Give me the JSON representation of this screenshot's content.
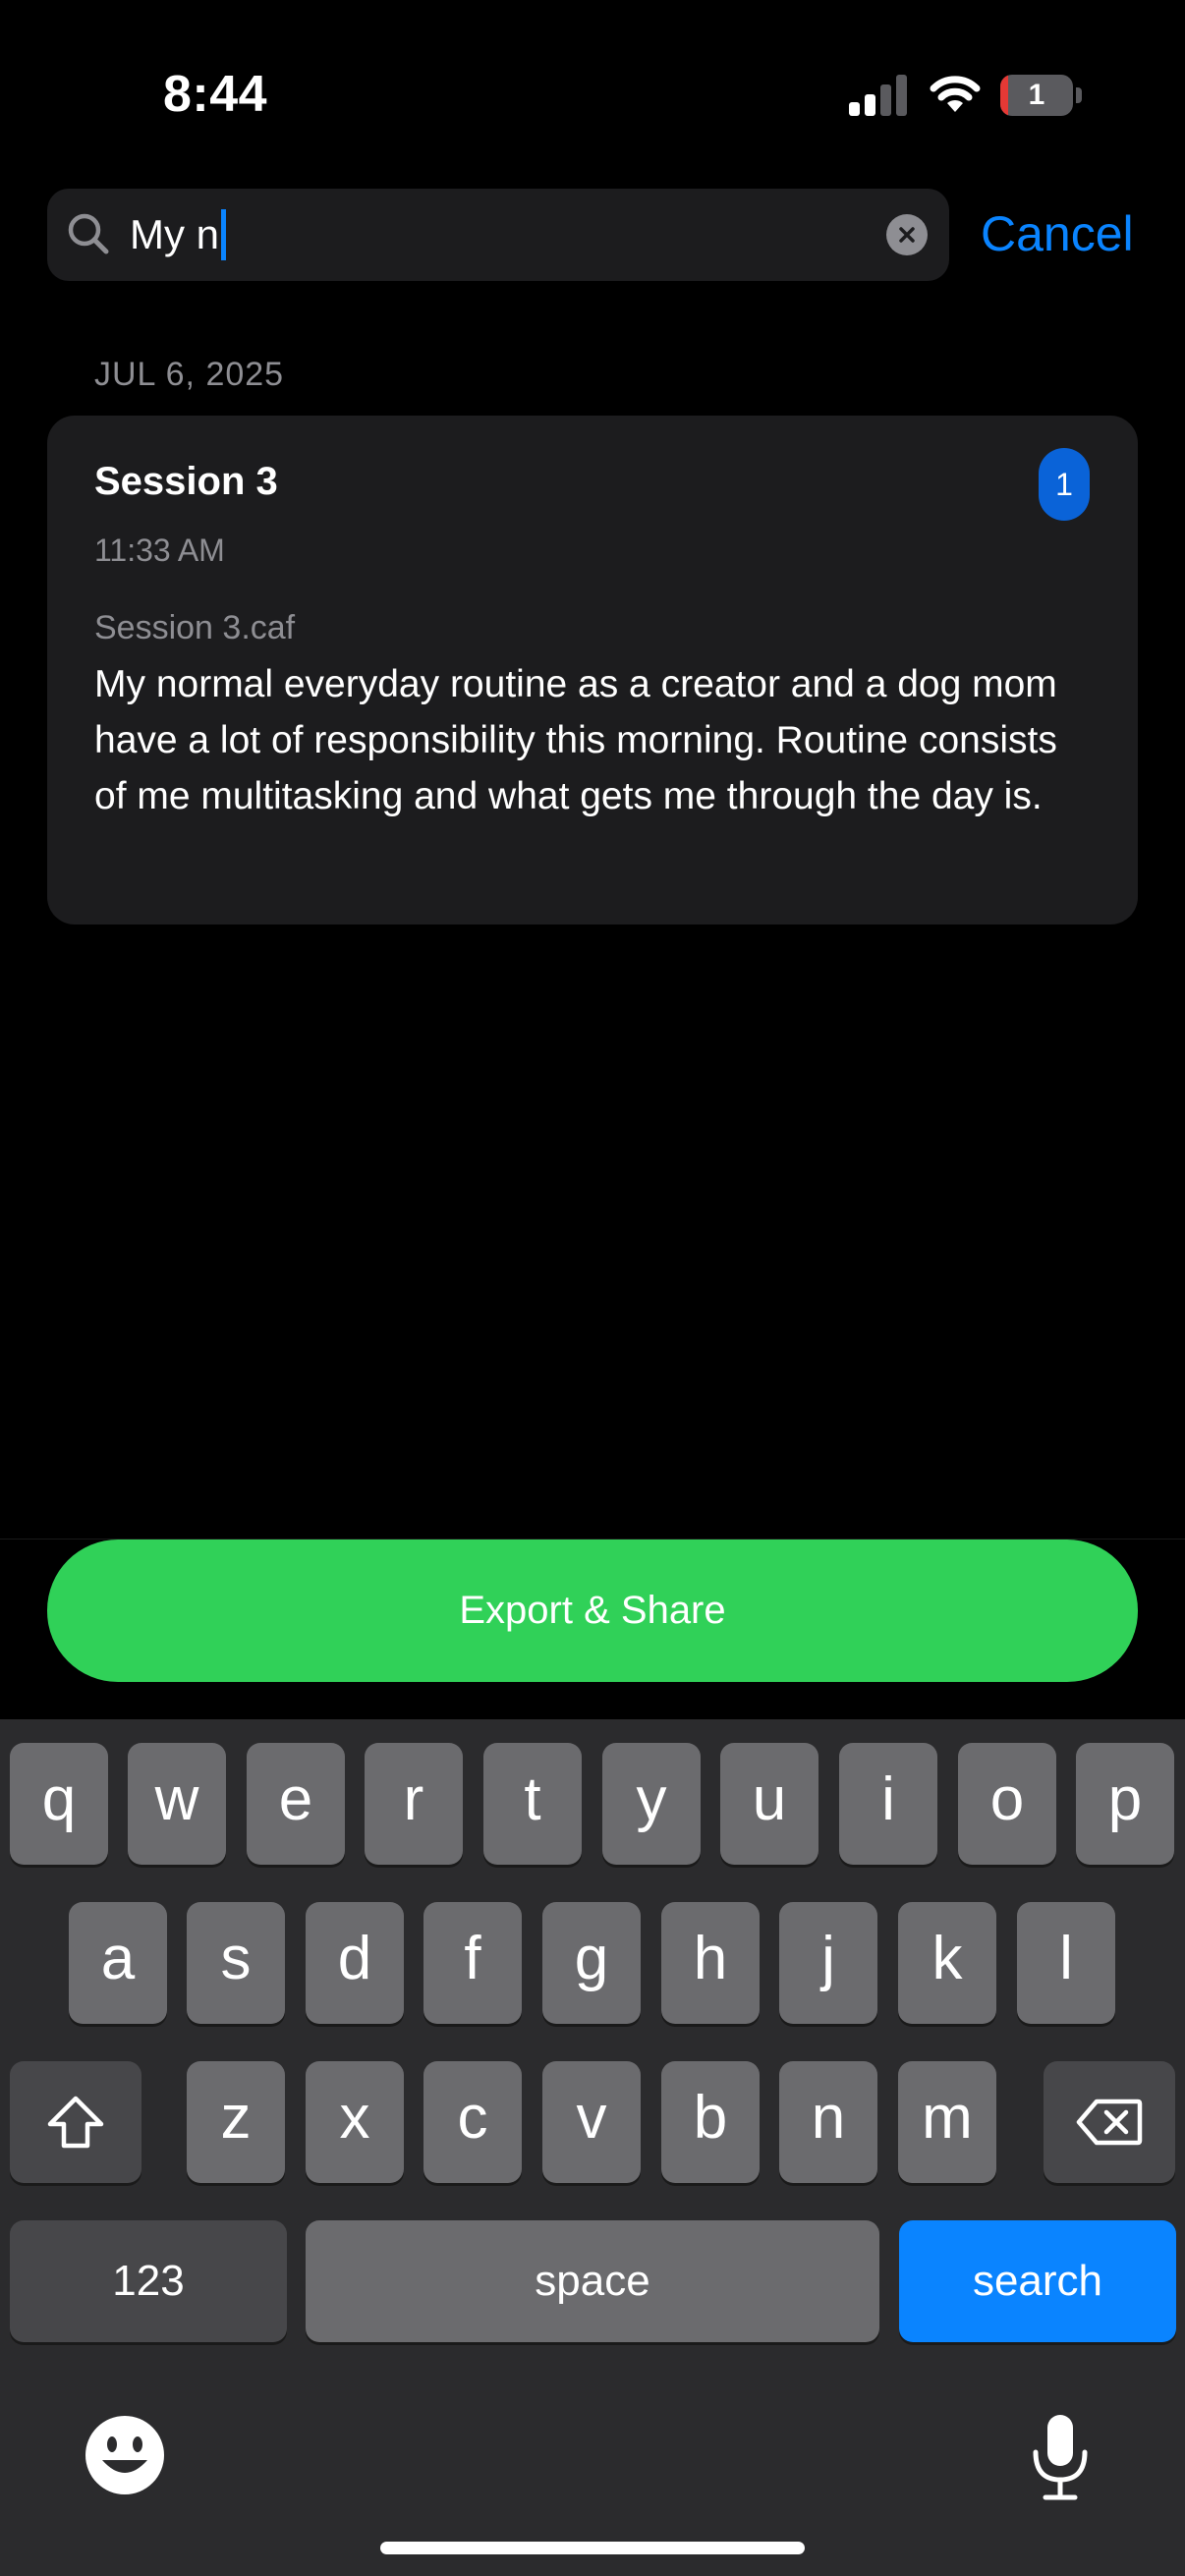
{
  "status_bar": {
    "time": "8:44",
    "battery_level": "1",
    "battery_color": "#e53935"
  },
  "search": {
    "query": "My n",
    "cancel_label": "Cancel"
  },
  "results": {
    "date_header": "JUL 6, 2025",
    "items": [
      {
        "title": "Session 3",
        "time": "11:33 AM",
        "badge": "1",
        "file": "Session 3.caf",
        "excerpt": "My normal everyday routine as a creator and a dog mom have a lot of responsibility this morning. Routine consists of me multitasking and what gets me through the day is."
      }
    ]
  },
  "export_button": {
    "label": "Export & Share",
    "color": "#30d158"
  },
  "keyboard": {
    "row1": [
      "q",
      "w",
      "e",
      "r",
      "t",
      "y",
      "u",
      "i",
      "o",
      "p"
    ],
    "row2": [
      "a",
      "s",
      "d",
      "f",
      "g",
      "h",
      "j",
      "k",
      "l"
    ],
    "row3": [
      "z",
      "x",
      "c",
      "v",
      "b",
      "n",
      "m"
    ],
    "numbers_label": "123",
    "space_label": "space",
    "search_label": "search",
    "accent_color": "#0a84ff"
  }
}
